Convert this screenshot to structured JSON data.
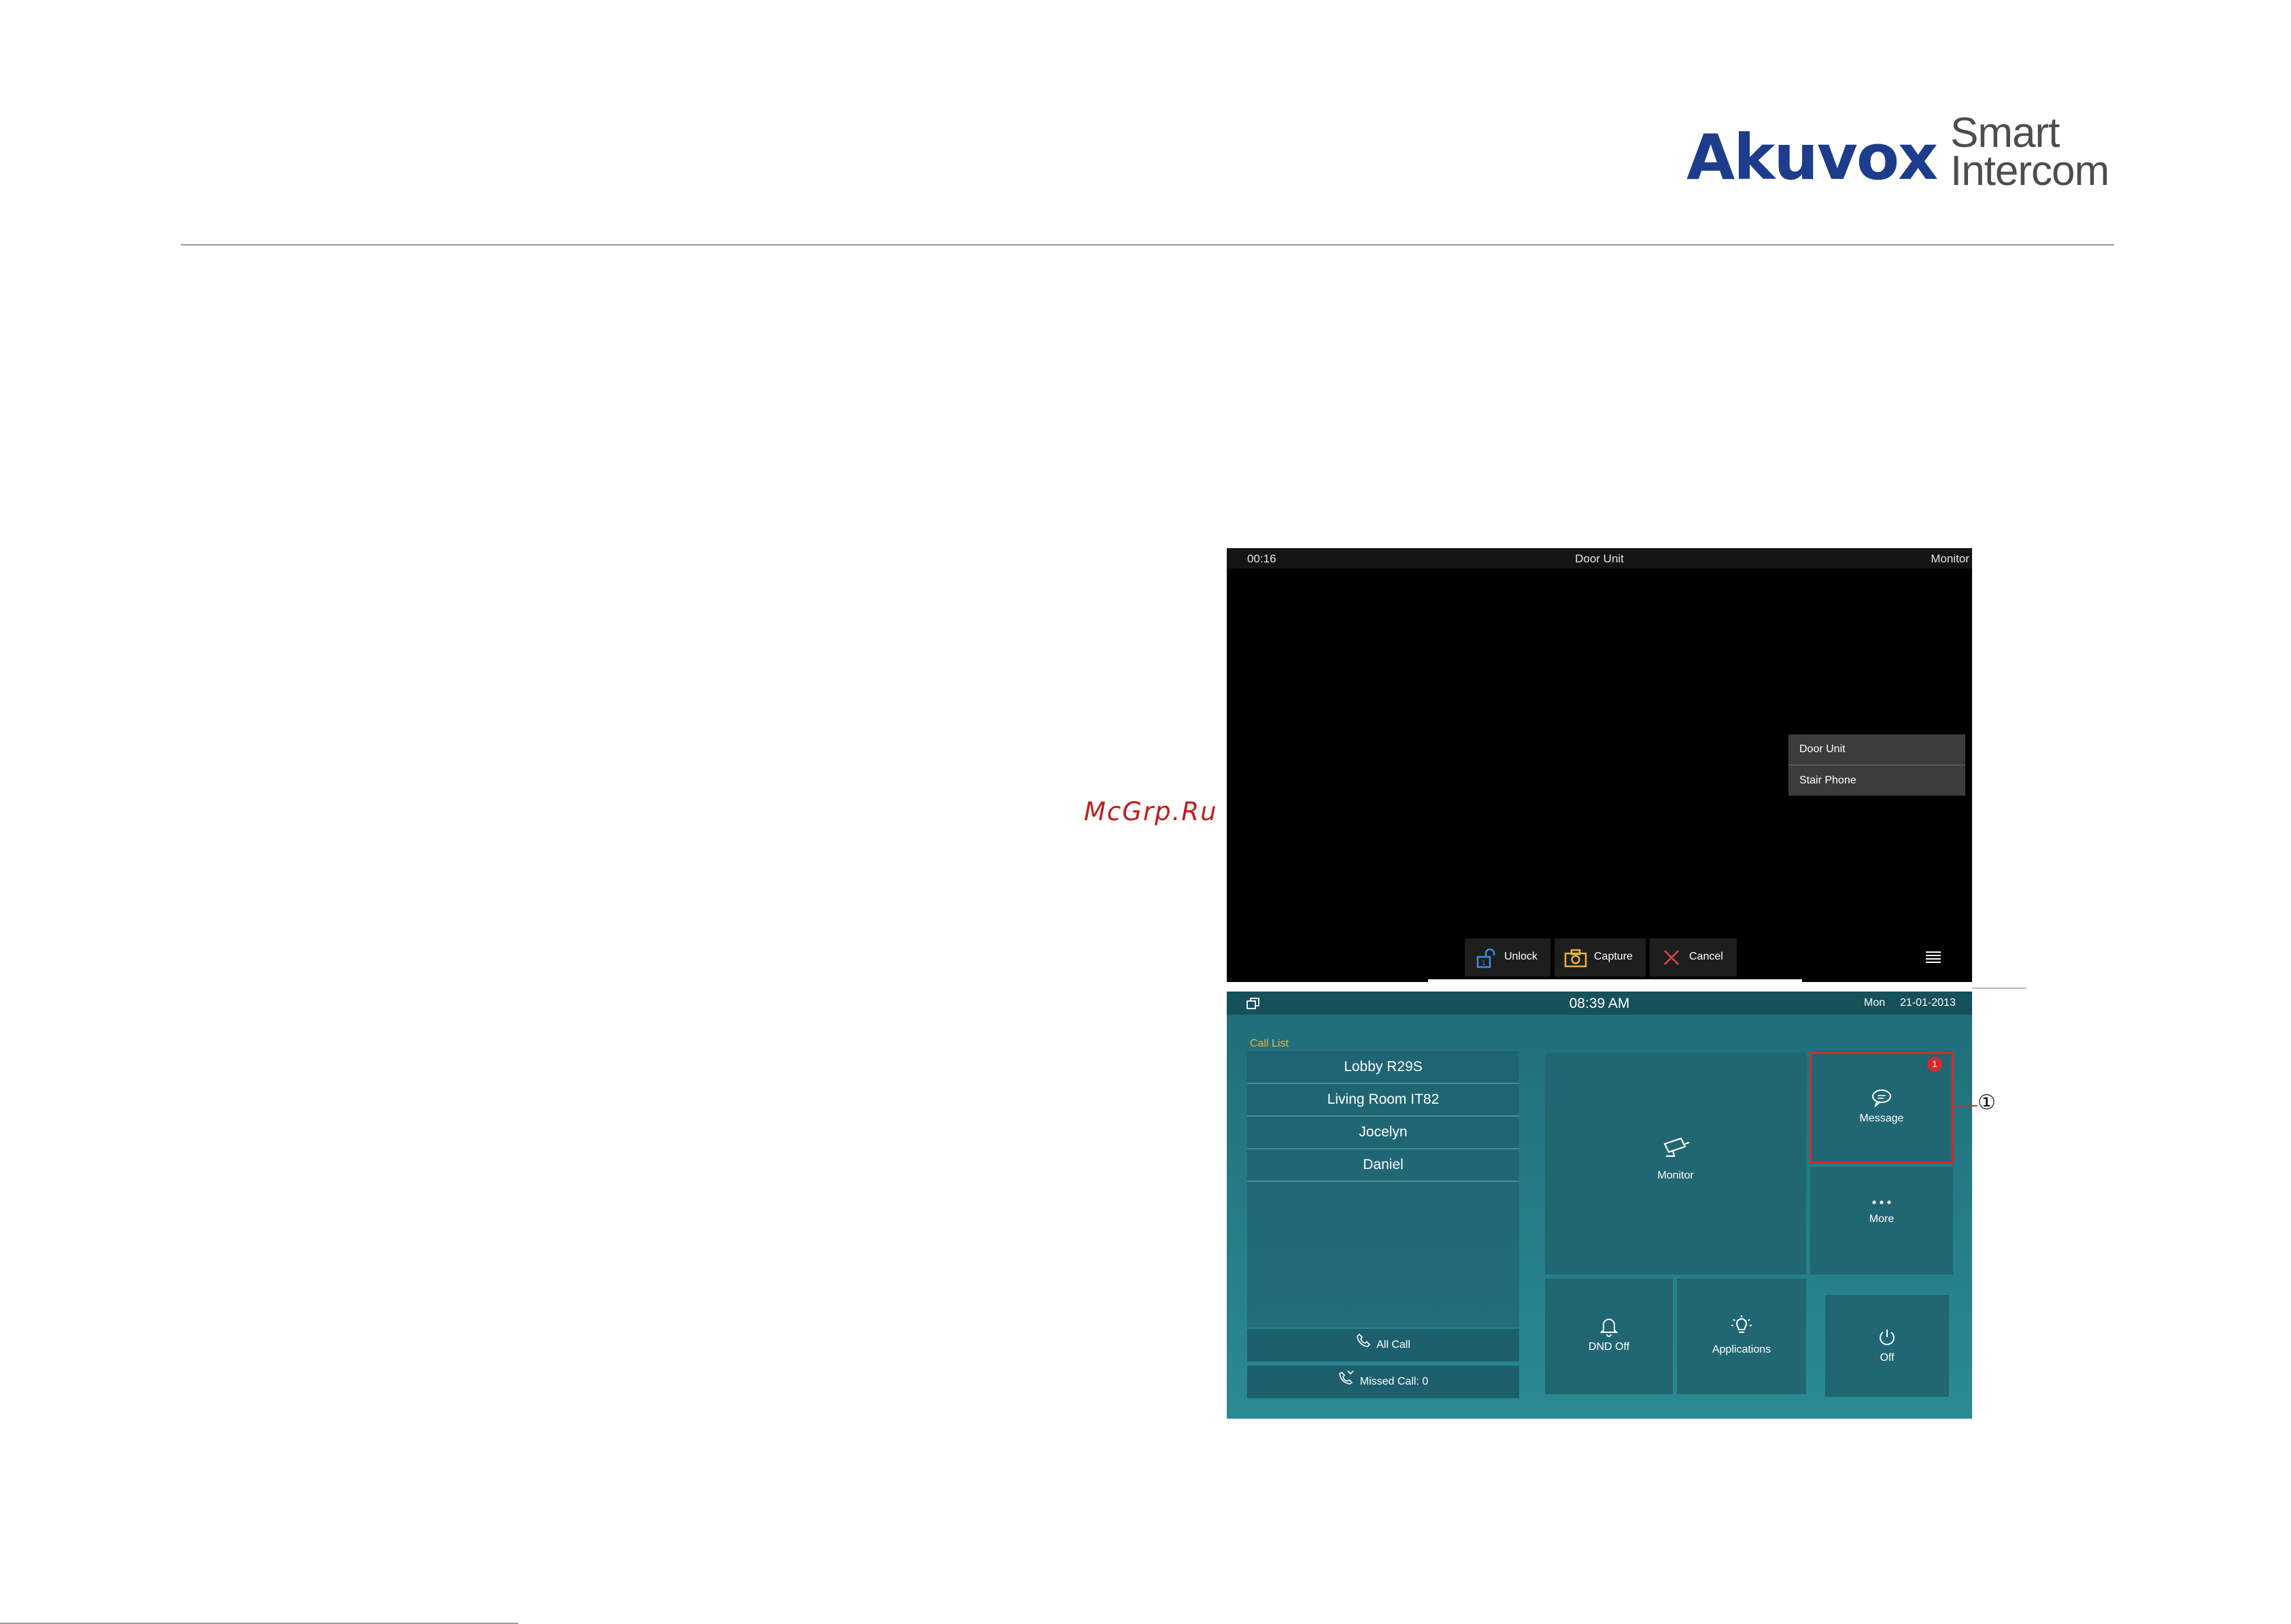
{
  "brand": {
    "logo_main": "Akuvox",
    "logo_sub_1": "Smart",
    "logo_sub_2": "Intercom",
    "color": "#1d3c8c"
  },
  "watermark": "McGrp.Ru",
  "monitor_screen": {
    "timer": "00:16",
    "title": "Door Unit",
    "mode": "Monitor",
    "dropdown_items": [
      "Door Unit",
      "Stair Phone"
    ],
    "actions": {
      "unlock": "Unlock",
      "capture": "Capture",
      "cancel": "Cancel"
    },
    "icons": {
      "unlock": "unlock-icon",
      "capture": "camera-icon",
      "cancel": "close-icon",
      "menu": "menu-icon"
    }
  },
  "home_screen": {
    "time": "08:39 AM",
    "day": "Mon",
    "date": "21-01-2013",
    "call_list_title": "Call List",
    "call_list": [
      "Lobby R29S",
      "Living Room IT82",
      "Jocelyn",
      "Daniel"
    ],
    "all_call": "All Call",
    "missed_call": "Missed Call: 0",
    "tiles": {
      "monitor": "Monitor",
      "message": "Message",
      "message_badge": "1",
      "more": "More",
      "dnd": "DND Off",
      "applications": "Applications",
      "off": "Off"
    },
    "accent_color": "#d82a2a"
  },
  "callout_marker": "①"
}
